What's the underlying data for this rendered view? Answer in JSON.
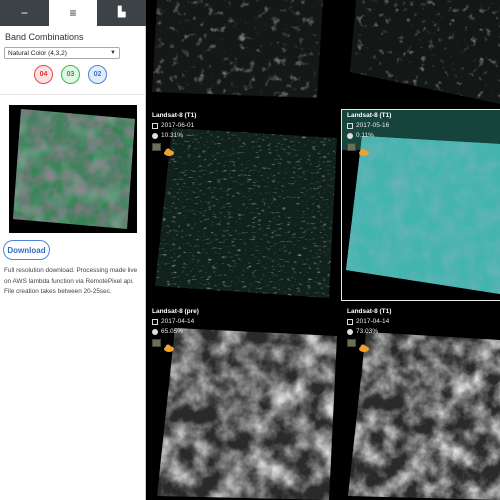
{
  "tabs": [
    {
      "name": "minus",
      "glyph": "−"
    },
    {
      "name": "menu",
      "glyph": "≡"
    },
    {
      "name": "grid",
      "glyph": "▙"
    }
  ],
  "sidebar": {
    "section_title": "Band Combinations",
    "select_value": "Natural Color (4,3,2)",
    "bands": [
      "04",
      "03",
      "02"
    ],
    "download_label": "Download",
    "download_note": "Full resolution download. Processing made live on AWS lambda function via RemotePixel api. File creation takes between 20-25sec."
  },
  "scenes": [
    {
      "sat": "",
      "date": "",
      "cloud": ""
    },
    {
      "sat": "",
      "date": "",
      "cloud": ""
    },
    {
      "sat": "Landsat-8 (T1)",
      "date": "2017-06-01",
      "cloud": "10.31%"
    },
    {
      "sat": "Landsat-8 (T1)",
      "date": "2017-05-16",
      "cloud": "0.11%"
    },
    {
      "sat": "Landsat-8 (pre)",
      "date": "2017-04-14",
      "cloud": "65.05%"
    },
    {
      "sat": "Landsat-8 (T1)",
      "date": "2017-04-14",
      "cloud": "73.03%"
    }
  ],
  "colors": {
    "tab_bg": "#3d4246",
    "accent_blue": "#2f6bc7",
    "selected_outline": "#e8e8e8",
    "cloud_icon": "#f0a030"
  }
}
